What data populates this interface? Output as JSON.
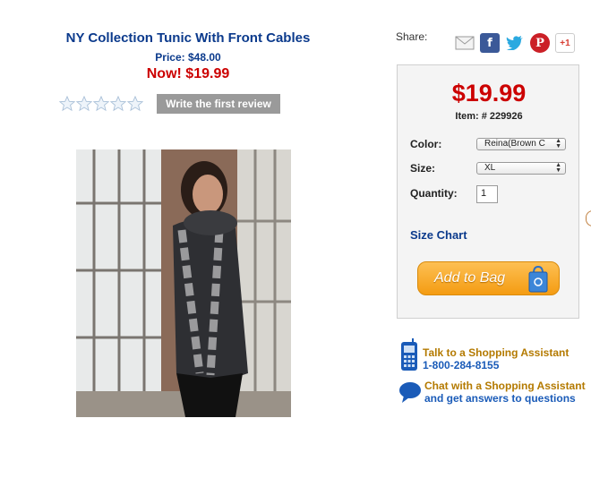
{
  "product": {
    "title": "NY Collection Tunic With Front Cables",
    "price_label": "Price: $48.00",
    "now_label": "Now! $19.99"
  },
  "reviews": {
    "rating": 0,
    "max": 5,
    "button_label": "Write the first review"
  },
  "share": {
    "label": "Share:",
    "icons": [
      "email-icon",
      "facebook-icon",
      "twitter-icon",
      "pinterest-icon",
      "google-plus-icon"
    ],
    "gplus_text": "+1"
  },
  "buybox": {
    "price": "$19.99",
    "item_number": "Item: # 229926",
    "color_label": "Color:",
    "color_value": "Reina(Brown C",
    "size_label": "Size:",
    "size_value": "XL",
    "quantity_label": "Quantity:",
    "quantity_value": "1",
    "size_chart": "Size Chart",
    "add_to_bag": "Add to Bag"
  },
  "assistant": {
    "talk_line1": "Talk to a Shopping Assistant",
    "talk_line2": "1-800-284-8155",
    "chat_line1": "Chat with a Shopping Assistant",
    "chat_line2": "and get answers to questions"
  },
  "colors": {
    "title_blue": "#0b3a8c",
    "sale_red": "#cc0000",
    "button_orange": "#f49c12"
  }
}
